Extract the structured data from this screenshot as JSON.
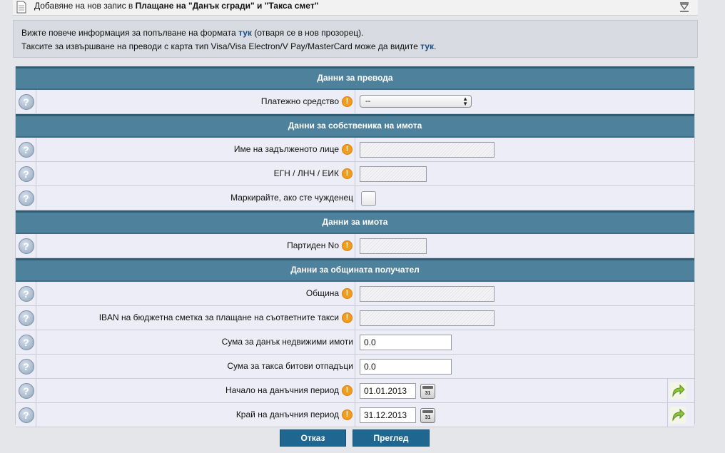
{
  "titlebar": {
    "prefix": "Добавяне на нов запис в ",
    "title_bold": "Плащане на \"Данък сгради\" и \"Такса смет\""
  },
  "info": {
    "line1_before": "Вижте повече информация за попълване на формата ",
    "line1_link": "тук",
    "line1_after": " (отваря се в нов прозорец).",
    "line2_before": "Таксите за извършване на преводи с карта тип Visa/Visa Electron/V Pay/MasterCard може да видите ",
    "line2_link": "тук",
    "line2_after": "."
  },
  "sections": {
    "transfer": "Данни за превода",
    "owner": "Данни за собственика на имота",
    "property": "Данни за имота",
    "municipality": "Данни за общината получател"
  },
  "fields": {
    "payment_method": {
      "label": "Платежно средство",
      "value": "--"
    },
    "debtor_name": {
      "label": "Име на задълженото лице"
    },
    "egn": {
      "label": "ЕГН / ЛНЧ / ЕИК"
    },
    "foreigner": {
      "label": "Маркирайте, ако сте чужденец"
    },
    "parcel_no": {
      "label": "Партиден No"
    },
    "municipality": {
      "label": "Община"
    },
    "iban": {
      "label": "IBAN на бюджетна сметка за плащане на съответните такси"
    },
    "property_tax": {
      "label": "Сума за данък недвижими имоти",
      "value": "0.0"
    },
    "waste_fee": {
      "label": "Сума за такса битови отпадъци",
      "value": "0.0"
    },
    "period_start": {
      "label": "Начало на данъчния период",
      "value": "01.01.2013"
    },
    "period_end": {
      "label": "Край на данъчния период",
      "value": "31.12.2013"
    }
  },
  "icons": {
    "help": "?",
    "required": "!",
    "calendar_day": "31"
  },
  "buttons": {
    "cancel": "Отказ",
    "review": "Преглед"
  },
  "colors": {
    "section_header": "#4e819c",
    "button": "#1f6790",
    "required": "#f39c1b",
    "link": "#1a4f83"
  }
}
